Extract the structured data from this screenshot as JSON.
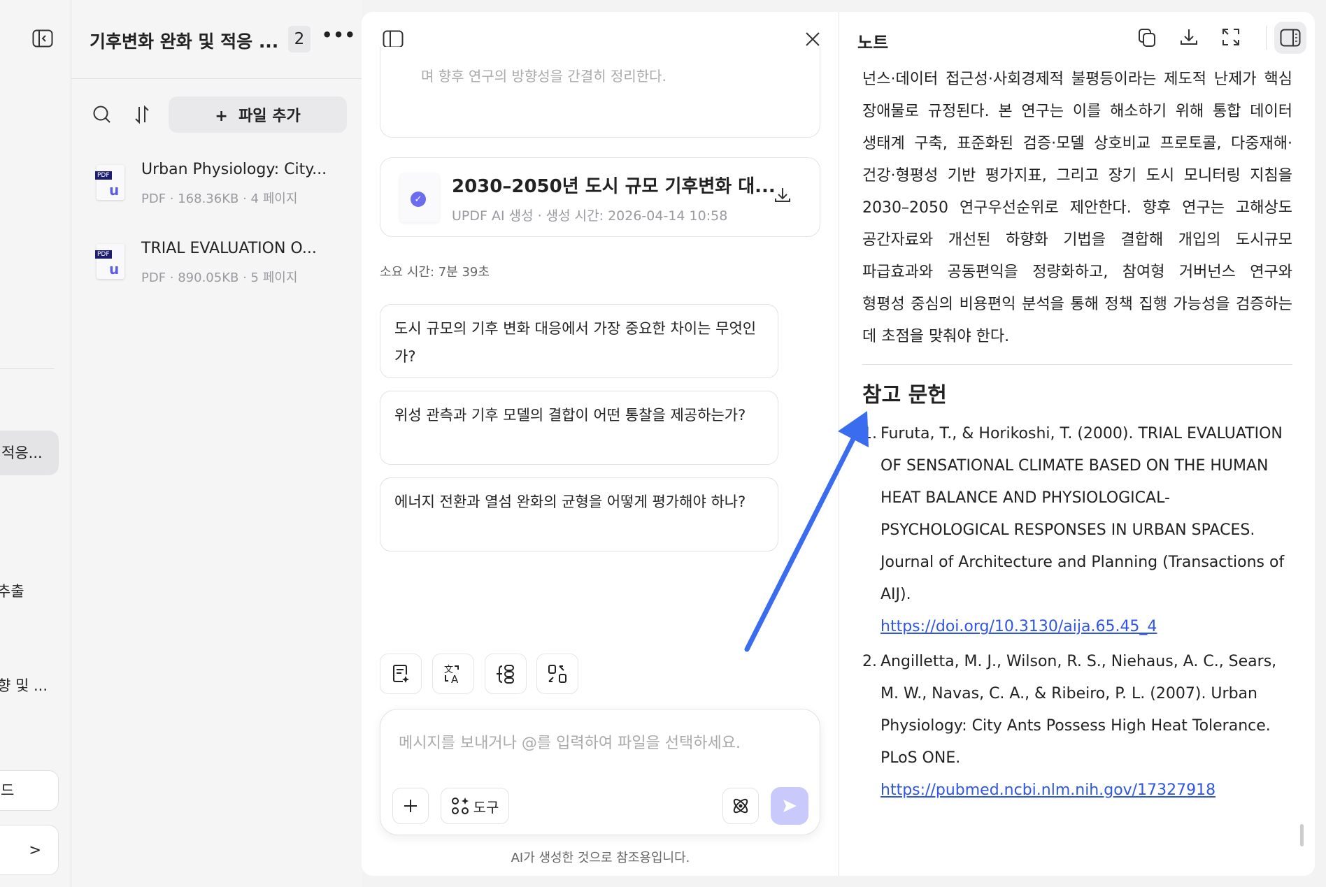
{
  "sidebar_strip": {
    "items": [
      "적응...",
      "추출",
      "향 및 ..."
    ],
    "button_label": "드",
    "expand_label": ">"
  },
  "left_panel": {
    "title": "기후변화 완화 및 적응 ...",
    "file_count": "2",
    "add_file_label": "+  파일 추가",
    "files": [
      {
        "name": "Urban Physiology: City...",
        "meta": "PDF · 168.36KB · 4 페이지",
        "badge": "PDF"
      },
      {
        "name": "TRIAL EVALUATION O...",
        "meta": "PDF · 890.05KB · 5 페이지",
        "badge": "PDF"
      }
    ]
  },
  "chat": {
    "prev_text": "며 향후 연구의 방향성을 간결히 정리한다.",
    "generated_file": {
      "title": "2030–2050년 도시 규모 기후변화 대...",
      "meta": "UPDF AI 생성 · 생성 시간: 2026-04-14 10:58"
    },
    "elapsed": "소요 시간: 7분 39초",
    "suggestions": [
      "도시 규모의 기후 변화 대응에서 가장 중요한 차이는 무엇인가?",
      "위성 관측과 기후 모델의 결합이 어떤 통찰을 제공하는가?",
      "에너지 전환과 열섬 완화의 균형을 어떻게 평가해야 하나?"
    ],
    "input_placeholder": "메시지를 보내거나 @를 입력하여 파일을 선택하세요.",
    "tools_label": "도구",
    "footer": "AI가 생성한 것으로 참조용입니다."
  },
  "note": {
    "title": "노트",
    "body": "넌스·데이터 접근성·사회경제적 불평등이라는 제도적 난제가 핵심 장애물로 규정된다. 본 연구는 이를 해소하기 위해 통합 데이터 생태계 구축, 표준화된 검증·모델 상호비교 프로토콜, 다중재해·건강·형평성 기반 평가지표, 그리고 장기 도시 모니터링 지침을 2030–2050 연구우선순위로 제안한다. 향후 연구는 고해상도 공간자료와 개선된 하향화 기법을 결합해 개입의 도시규모 파급효과와 공동편익을 정량화하고, 참여형 거버넌스 연구와 형평성 중심의 비용편익 분석을 통해 정책 집행 가능성을 검증하는 데 초점을 맞춰야 한다.",
    "references_heading": "참고 문헌",
    "references": [
      {
        "num": "1.",
        "text": "Furuta, T., & Horikoshi, T. (2000). TRIAL EVALUATION OF SENSATIONAL CLIMATE BASED ON THE HUMAN HEAT BALANCE AND PHYSIOLOGICAL-PSYCHOLOGICAL RESPONSES IN URBAN SPACES. Journal of Architecture and Planning (Transactions of AIJ).",
        "link": "https://doi.org/10.3130/aija.65.45_4"
      },
      {
        "num": "2.",
        "text": "Angilletta, M. J., Wilson, R. S., Niehaus, A. C., Sears, M. W., Navas, C. A., & Ribeiro, P. L. (2007). Urban Physiology: City Ants Possess High Heat Tolerance. PLoS ONE.",
        "link": "https://pubmed.ncbi.nlm.nih.gov/17327918"
      }
    ]
  },
  "colors": {
    "accent": "#6c6cf0",
    "link": "#2f55e4",
    "arrow": "#3a6cf0",
    "send_disabled": "#c9c9fb"
  }
}
